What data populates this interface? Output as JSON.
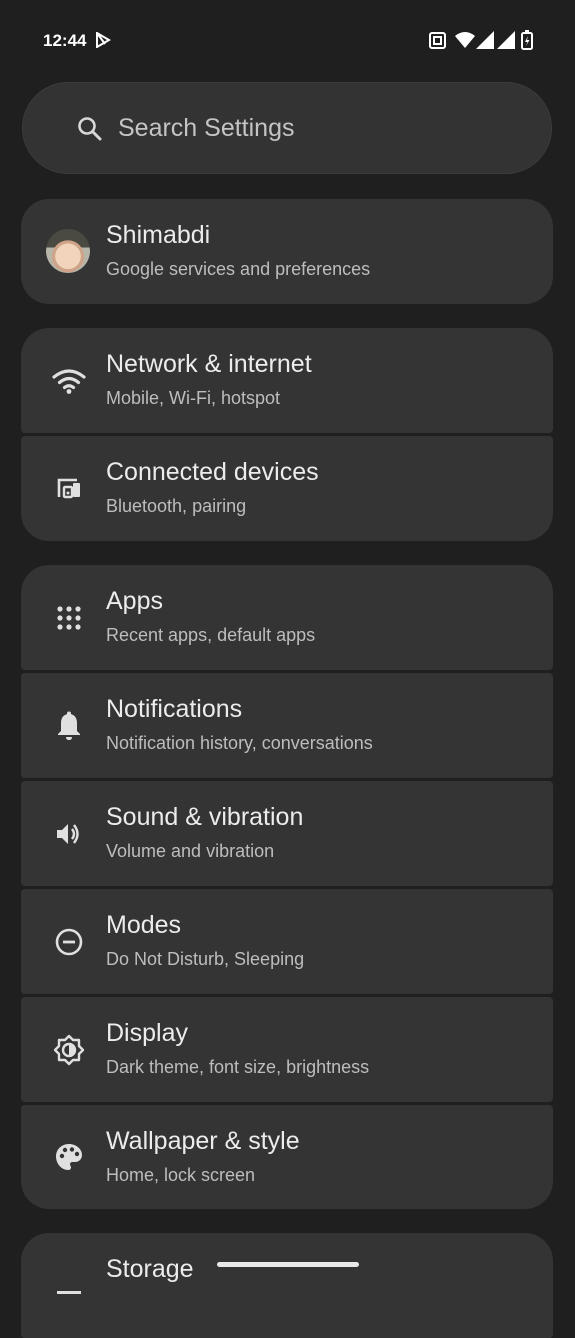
{
  "status_bar": {
    "time": "12:44",
    "icons": [
      "play-store-notification-icon",
      "nfc-icon",
      "wifi-icon",
      "signal-icon",
      "signal-icon",
      "battery-charging-icon"
    ]
  },
  "search": {
    "placeholder": "Search Settings",
    "icon": "search-icon"
  },
  "account": {
    "name": "Shimabdi",
    "subtitle": "Google services and preferences"
  },
  "items": [
    {
      "title": "Network & internet",
      "subtitle": "Mobile, Wi-Fi, hotspot",
      "icon": "wifi-icon"
    },
    {
      "title": "Connected devices",
      "subtitle": "Bluetooth, pairing",
      "icon": "connected-devices-icon"
    },
    {
      "title": "Apps",
      "subtitle": "Recent apps, default apps",
      "icon": "apps-grid-icon"
    },
    {
      "title": "Notifications",
      "subtitle": "Notification history, conversations",
      "icon": "bell-icon"
    },
    {
      "title": "Sound & vibration",
      "subtitle": "Volume and vibration",
      "icon": "volume-icon"
    },
    {
      "title": "Modes",
      "subtitle": "Do Not Disturb, Sleeping",
      "icon": "do-not-disturb-icon"
    },
    {
      "title": "Display",
      "subtitle": "Dark theme, font size, brightness",
      "icon": "brightness-icon"
    },
    {
      "title": "Wallpaper & style",
      "subtitle": "Home, lock screen",
      "icon": "palette-icon"
    },
    {
      "title": "Storage",
      "icon": "storage-icon"
    }
  ],
  "colors": {
    "background": "#1f1f1f",
    "card": "#343434",
    "text": "#e3e3e3",
    "secondary_text": "#bdbdbd"
  }
}
